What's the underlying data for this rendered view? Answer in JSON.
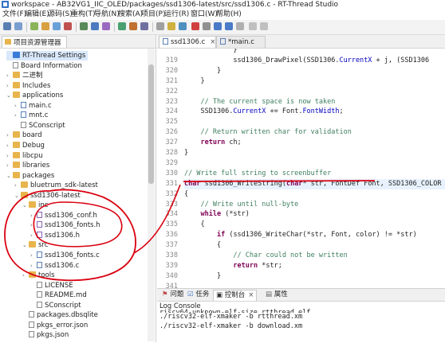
{
  "window": {
    "title": "workspace - AB32VG1_IIC_OLED/packages/ssd1306-latest/src/ssd1306.c - RT-Thread Studio"
  },
  "menu": [
    "文件(F)",
    "编辑(E)",
    "源码(S)",
    "重构(T)",
    "导航(N)",
    "搜索(A)",
    "项目(P)",
    "运行(R)",
    "窗口(W)",
    "帮助(H)"
  ],
  "left_panel": {
    "tab_label": "项目资源管理器",
    "tree": [
      {
        "label": "RT-Thread Settings",
        "kind": "settings"
      },
      {
        "label": "Board Information",
        "kind": "info"
      },
      {
        "label": "二进制",
        "kind": "folder",
        "arrow": ">"
      },
      {
        "label": "Includes",
        "kind": "folder",
        "arrow": ">"
      },
      {
        "label": "applications",
        "kind": "folder",
        "arrow": "v"
      },
      {
        "label": "main.c",
        "kind": "file-c",
        "arrow": ">"
      },
      {
        "label": "mnt.c",
        "kind": "file-c",
        "arrow": ">"
      },
      {
        "label": "SConscript",
        "kind": "file-t"
      },
      {
        "label": "board",
        "kind": "folder",
        "arrow": ">"
      },
      {
        "label": "Debug",
        "kind": "folder",
        "arrow": ">"
      },
      {
        "label": "libcpu",
        "kind": "folder",
        "arrow": ">"
      },
      {
        "label": "libraries",
        "kind": "folder",
        "arrow": ">"
      },
      {
        "label": "packages",
        "kind": "folder",
        "arrow": "v"
      },
      {
        "label": "bluetrum_sdk-latest",
        "kind": "folder",
        "arrow": ">"
      },
      {
        "label": "ssd1306-latest",
        "kind": "folder",
        "arrow": "v"
      },
      {
        "label": "inc",
        "kind": "folder",
        "arrow": "v"
      },
      {
        "label": "ssd1306_conf.h",
        "kind": "file-h",
        "arrow": ">"
      },
      {
        "label": "ssd1306_fonts.h",
        "kind": "file-h",
        "arrow": ">"
      },
      {
        "label": "ssd1306.h",
        "kind": "file-h",
        "arrow": ">"
      },
      {
        "label": "src",
        "kind": "folder",
        "arrow": "v"
      },
      {
        "label": "ssd1306_fonts.c",
        "kind": "file-c",
        "arrow": ">"
      },
      {
        "label": "ssd1306.c",
        "kind": "file-c",
        "arrow": ">"
      },
      {
        "label": "tools",
        "kind": "folder",
        "arrow": ">"
      },
      {
        "label": "LICENSE",
        "kind": "file-t"
      },
      {
        "label": "README.md",
        "kind": "file-t"
      },
      {
        "label": "SConscript",
        "kind": "file-t"
      },
      {
        "label": "packages.dbsqlite",
        "kind": "file-t"
      },
      {
        "label": "pkgs_error.json",
        "kind": "file-t"
      },
      {
        "label": "pkgs.json",
        "kind": "file-t"
      }
    ]
  },
  "editor": {
    "tabs": [
      {
        "label": "ssd1306.c",
        "active": true
      },
      {
        "label": "*main.c",
        "active": false
      }
    ],
    "line_numbers": [
      "",
      "319",
      "320",
      "321",
      "322",
      "323",
      "324",
      "325",
      "326",
      "327",
      "328",
      "329",
      "330",
      "331",
      "332",
      "333",
      "334",
      "335",
      "336",
      "337",
      "338",
      "339",
      "340",
      "341",
      "342",
      "343"
    ],
    "lines": [
      {
        "t": "            }"
      },
      {
        "t": "            ssd1306_DrawPixel(SSD1306.CurrentX + j, (SSD1306"
      },
      {
        "t": "        }"
      },
      {
        "t": "    }"
      },
      {
        "t": ""
      },
      {
        "t": "    // The current space is now taken",
        "cls": "cm"
      },
      {
        "t": "    SSD1306.CurrentX += Font.FontWidth;"
      },
      {
        "t": ""
      },
      {
        "t": "    // Return written char for validation",
        "cls": "cm"
      },
      {
        "t": "    return ch;"
      },
      {
        "t": "}"
      },
      {
        "t": ""
      },
      {
        "t": "// Write full string to screenbuffer",
        "cls": "cm"
      },
      {
        "t": "char ssd1306_WriteString(char* str, FontDef Font, SSD1306_COLOR",
        "hl": true
      },
      {
        "t": "{"
      },
      {
        "t": "    // Write until null-byte",
        "cls": "cm"
      },
      {
        "t": "    while (*str)"
      },
      {
        "t": "    {"
      },
      {
        "t": "        if (ssd1306_WriteChar(*str, Font, color) != *str)"
      },
      {
        "t": "        {"
      },
      {
        "t": "            // Char could not be written",
        "cls": "cm"
      },
      {
        "t": "            return *str;"
      },
      {
        "t": "        }"
      },
      {
        "t": ""
      }
    ]
  },
  "console": {
    "tabs": [
      "问题",
      "任务",
      "控制台",
      "属性"
    ],
    "title": "Log Console",
    "lines": [
      "./riscv32-elf-xmaker -b rtthread.xm",
      "./riscv32-elf-xmaker -b download.xm"
    ],
    "partial_top_line": "riscv64-unknown-elf-size rtthread.elf"
  },
  "colors": {
    "annotation": "#d9000f",
    "keyword": "#7f0055",
    "comment": "#3f7f5f",
    "field": "#0000c0"
  }
}
